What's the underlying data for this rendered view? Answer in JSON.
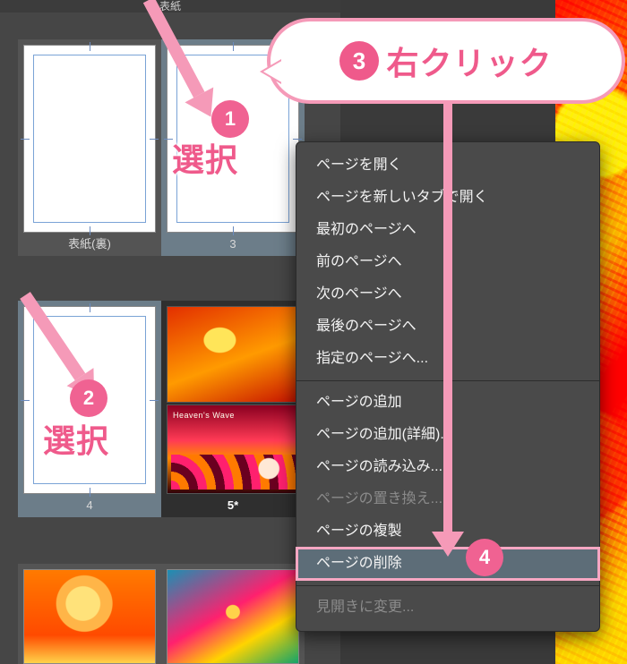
{
  "colors": {
    "accent_pink": "#ef5a8b",
    "arrow_pink": "#f59ab8",
    "menu_bg": "#4a4a4a",
    "panel_bg": "#464646",
    "select_bg": "#6c7d89"
  },
  "header": {
    "title": "表紙"
  },
  "thumbs": {
    "r1": {
      "left_label": "表紙(裏)",
      "right_label": "3"
    },
    "r2": {
      "left_label": "4",
      "right_label": "5*"
    },
    "art5_caption": "Heaven's Wave"
  },
  "annotations": {
    "step1": {
      "num": "1",
      "text": "選択"
    },
    "step2": {
      "num": "2",
      "text": "選択"
    },
    "step3": {
      "num": "3",
      "text": "右クリック"
    },
    "step4": {
      "num": "4"
    }
  },
  "context_menu": {
    "group1": [
      "ページを開く",
      "ページを新しいタブで開く",
      "最初のページへ",
      "前のページへ",
      "次のページへ",
      "最後のページへ",
      "指定のページへ..."
    ],
    "group2": [
      "ページの追加",
      "ページの追加(詳細)...",
      "ページの読み込み..."
    ],
    "replace_disabled": "ページの置き換え...",
    "duplicate": "ページの複製",
    "delete": "ページの削除",
    "group3_disabled": [
      "見開きに変更..."
    ]
  }
}
